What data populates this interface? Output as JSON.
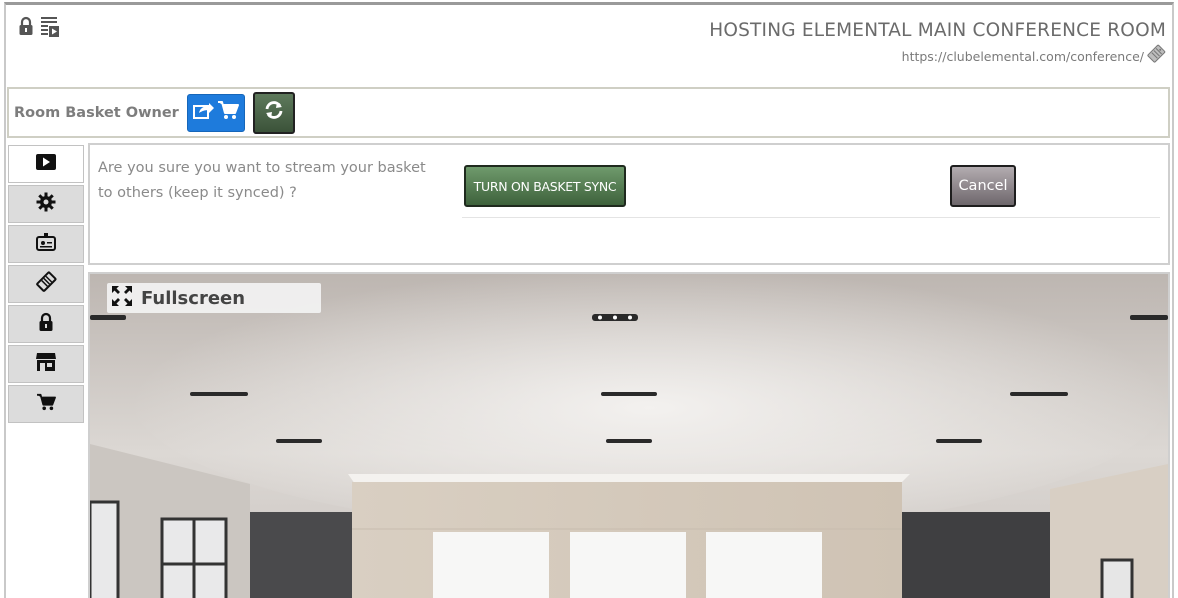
{
  "header": {
    "title": "HOSTING ELEMENTAL MAIN CONFERENCE ROOM",
    "url": "https://clubelemental.com/conference/",
    "icons": [
      "lock-icon",
      "playlist-icon",
      "tag-icon"
    ]
  },
  "owner_bar": {
    "label": "Room Basket Owner",
    "share_icon": "share-cart-icon",
    "sync_icon": "sync-icon"
  },
  "sidebar": {
    "items": [
      {
        "icon": "play-icon",
        "active": true
      },
      {
        "icon": "gear-icon"
      },
      {
        "icon": "id-badge-icon"
      },
      {
        "icon": "tag-icon"
      },
      {
        "icon": "lock-icon"
      },
      {
        "icon": "store-icon"
      },
      {
        "icon": "cart-icon"
      }
    ]
  },
  "confirm": {
    "message": "Are you sure you want to stream your basket to others (keep it synced) ?",
    "confirm_label": "TURN ON BASKET SYNC",
    "cancel_label": "Cancel"
  },
  "video": {
    "fullscreen_label": "Fullscreen",
    "fullscreen_icon": "expand-icon"
  },
  "colors": {
    "accent_blue": "#1e7bdc",
    "accent_green": "#4f744c",
    "cancel_gray": "#8a8387"
  }
}
